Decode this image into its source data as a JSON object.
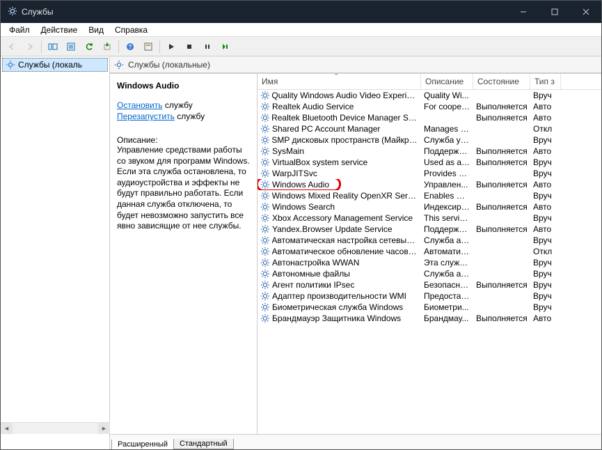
{
  "title": "Службы",
  "menu": [
    "Файл",
    "Действие",
    "Вид",
    "Справка"
  ],
  "tree_root": "Службы (локаль",
  "header_label": "Службы (локальные)",
  "detail": {
    "service_name": "Windows Audio",
    "stop": "Остановить",
    "stop_suffix": " службу",
    "restart": "Перезапустить",
    "restart_suffix": " службу",
    "desc_label": "Описание:",
    "desc_text": "Управление средствами работы со звуком для программ Windows.  Если эта служба остановлена, то аудиоустройства и эффекты не будут правильно работать.  Если данная служба отключена, то будет невозможно запустить все явно зависящие от нее службы."
  },
  "columns": {
    "name": "Имя",
    "desc": "Описание",
    "state": "Состояние",
    "type": "Тип з"
  },
  "rows": [
    {
      "name": "Quality Windows Audio Video Experience",
      "desc": "Quality Wi...",
      "state": "",
      "type": "Вруч"
    },
    {
      "name": "Realtek Audio Service",
      "desc": "For cooper...",
      "state": "Выполняется",
      "type": "Авто"
    },
    {
      "name": "Realtek Bluetooth Device Manager Servi...",
      "desc": "",
      "state": "Выполняется",
      "type": "Авто"
    },
    {
      "name": "Shared PC Account Manager",
      "desc": "Manages p...",
      "state": "",
      "type": "Откл"
    },
    {
      "name": "SMP дисковых пространств (Майкрос...",
      "desc": "Служба узл...",
      "state": "",
      "type": "Вруч"
    },
    {
      "name": "SysMain",
      "desc": "Поддержи...",
      "state": "Выполняется",
      "type": "Авто"
    },
    {
      "name": "VirtualBox system service",
      "desc": "Used as a ...",
      "state": "Выполняется",
      "type": "Вруч"
    },
    {
      "name": "WarpJITSvc",
      "desc": "Provides a ...",
      "state": "",
      "type": "Вруч"
    },
    {
      "name": "Windows Audio",
      "desc": "Управлен...",
      "state": "Выполняется",
      "type": "Авто",
      "highlight": true
    },
    {
      "name": "Windows Mixed Reality OpenXR Service",
      "desc": "Enables Mi...",
      "state": "",
      "type": "Вруч"
    },
    {
      "name": "Windows Search",
      "desc": "Индексиро...",
      "state": "Выполняется",
      "type": "Авто"
    },
    {
      "name": "Xbox Accessory Management Service",
      "desc": "This servic...",
      "state": "",
      "type": "Вруч"
    },
    {
      "name": "Yandex.Browser Update Service",
      "desc": "Поддержи...",
      "state": "Выполняется",
      "type": "Авто"
    },
    {
      "name": "Автоматическая настройка сетевых у...",
      "desc": "Служба ав...",
      "state": "",
      "type": "Вруч"
    },
    {
      "name": "Автоматическое обновление часовог...",
      "desc": "Автоматич...",
      "state": "",
      "type": "Откл"
    },
    {
      "name": "Автонастройка WWAN",
      "desc": "Эта служб...",
      "state": "",
      "type": "Вруч"
    },
    {
      "name": "Автономные файлы",
      "desc": "Служба ав...",
      "state": "",
      "type": "Вруч"
    },
    {
      "name": "Агент политики IPsec",
      "desc": "Безопасно...",
      "state": "Выполняется",
      "type": "Вруч"
    },
    {
      "name": "Адаптер производительности WMI",
      "desc": "Предостав...",
      "state": "",
      "type": "Вруч"
    },
    {
      "name": "Биометрическая служба Windows",
      "desc": "Биометри...",
      "state": "",
      "type": "Вруч"
    },
    {
      "name": "Брандмауэр Защитника Windows",
      "desc": "Брандмау...",
      "state": "Выполняется",
      "type": "Авто"
    }
  ],
  "tabs": {
    "ext": "Расширенный",
    "std": "Стандартный"
  }
}
